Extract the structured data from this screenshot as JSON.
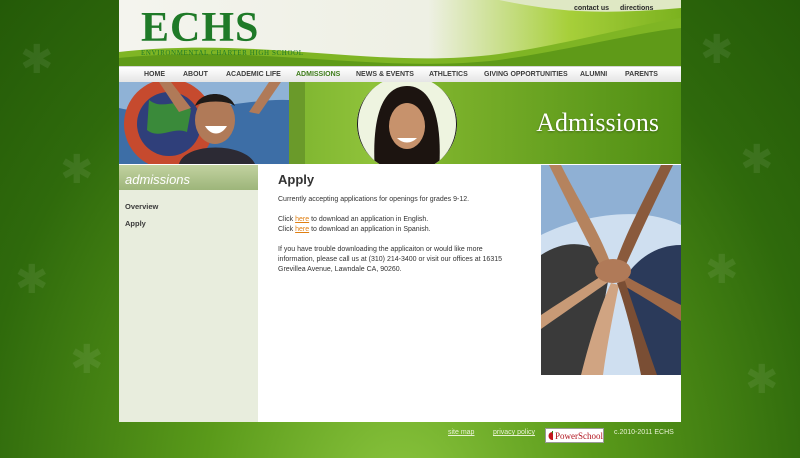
{
  "header": {
    "logo_text": "ECHS",
    "logo_subtitle": "ENVIRONMENTAL CHARTER HIGH SCHOOL",
    "top_links": [
      "contact us",
      "directions"
    ]
  },
  "nav": {
    "items": [
      "HOME",
      "ABOUT",
      "ACADEMIC LIFE",
      "ADMISSIONS",
      "NEWS & EVENTS",
      "ATHLETICS",
      "GIVING OPPORTUNITIES",
      "ALUMNI",
      "PARENTS"
    ],
    "active": "ADMISSIONS"
  },
  "banner": {
    "title": "Admissions"
  },
  "sidebar": {
    "title": "admissions",
    "links": [
      "Overview",
      "Apply"
    ]
  },
  "content": {
    "title": "Apply",
    "intro": "Currently accepting applications for openings for grades 9-12.",
    "english_prefix": "Click ",
    "english_link": "here",
    "english_suffix": " to download an application in English.",
    "spanish_prefix": "Click ",
    "spanish_link": "here",
    "spanish_suffix": " to download an application in Spanish.",
    "contact_line1": "If you have trouble downloading the applicaiton or would like more",
    "contact_line2": "information, please call us at (310) 214-3400 or visit our offices at  16315",
    "contact_line3": "Grevillea Avenue, Lawndale CA, 90260."
  },
  "footer": {
    "site_map": "site map",
    "privacy_policy": "privacy policy",
    "powerschool": "PowerSchool",
    "copyright": "c.2010-2011 ECHS"
  },
  "colors": {
    "brand_green": "#1f7a28",
    "nav_active": "#3e7c1a",
    "link_orange": "#e07f12"
  }
}
